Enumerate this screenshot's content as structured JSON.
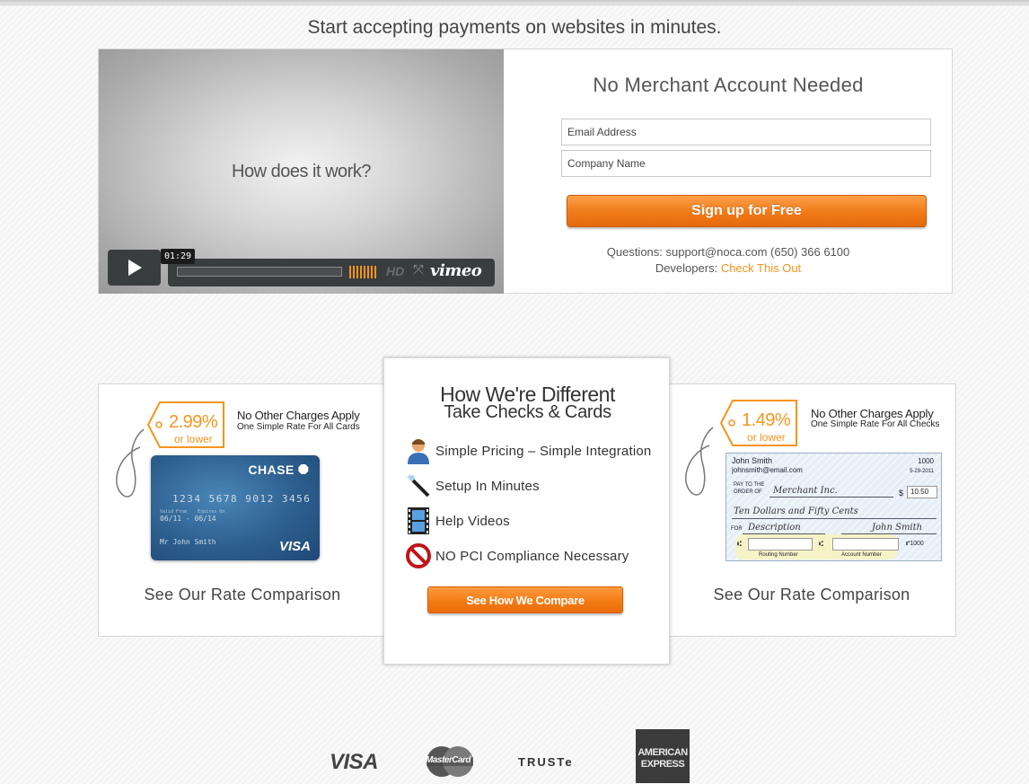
{
  "headline": "Start accepting payments on websites in minutes.",
  "video": {
    "title": "How does it work?",
    "time": "01:29",
    "hd": "HD",
    "brand": "vimeo",
    "icons": [
      "play-icon",
      "fullscreen-icon"
    ]
  },
  "signup": {
    "title": "No Merchant Account Needed",
    "email_placeholder": "Email Address",
    "company_placeholder": "Company Name",
    "button": "Sign up for Free",
    "questions_label": "Questions:",
    "questions_value": "support@noca.com (650) 366 6100",
    "developers_label": "Developers:",
    "developers_link": "Check This Out"
  },
  "cards_offer": {
    "rate": "2.99%",
    "rate_sub": "or lower",
    "apply_title": "No Other Charges Apply",
    "apply_sub": "One Simple Rate For All Cards",
    "card": {
      "issuer": "CHASE",
      "number": "1234 5678 9012 3456",
      "valid_from_label": "Valid From",
      "expires_label": "Expires On",
      "dates": "06/11 - 06/14",
      "holder": "Mr John Smith",
      "brand": "VISA"
    },
    "link": "See Our Rate Comparison"
  },
  "checks_offer": {
    "rate": "1.49%",
    "rate_sub": "or lower",
    "apply_title": "No Other Charges Apply",
    "apply_sub": "One Simple Rate For All Checks",
    "check": {
      "name": "John Smith",
      "email": "johnsmith@email.com",
      "number": "1000",
      "date": "5-29-2011",
      "pay_to_label_1": "PAY TO THE",
      "pay_to_label_2": "ORDER OF",
      "payee": "Merchant Inc.",
      "dollar": "$",
      "amount": "10.50",
      "amount_words": "Ten Dollars and Fifty Cents",
      "for_label": "FOR",
      "memo": "Description",
      "signature": "John Smith",
      "micr_end": "1000",
      "routing_label": "Routing Number",
      "account_label": "Account Number"
    },
    "link": "See Our Rate Comparison"
  },
  "different": {
    "title": "How We're Different",
    "subtitle": "Take Checks & Cards",
    "features": [
      {
        "label": "Simple Pricing – Simple Integration",
        "icon": "person-icon"
      },
      {
        "label": "Setup In Minutes",
        "icon": "magic-wand-icon"
      },
      {
        "label": "Help Videos",
        "icon": "film-strip-icon"
      },
      {
        "label": "NO PCI Compliance Necessary",
        "icon": "no-entry-icon"
      }
    ],
    "button": "See How We Compare"
  },
  "payment_logos": {
    "visa": "VISA",
    "mastercard": "MasterCard",
    "truste": "TRUSTe",
    "amex_line1": "AMERICAN",
    "amex_line2": "EXPRESS"
  },
  "colors": {
    "accent_orange": "#f7941d",
    "video_control_bg": "#3a3d3e",
    "card_blue": "#2d5f8e"
  }
}
